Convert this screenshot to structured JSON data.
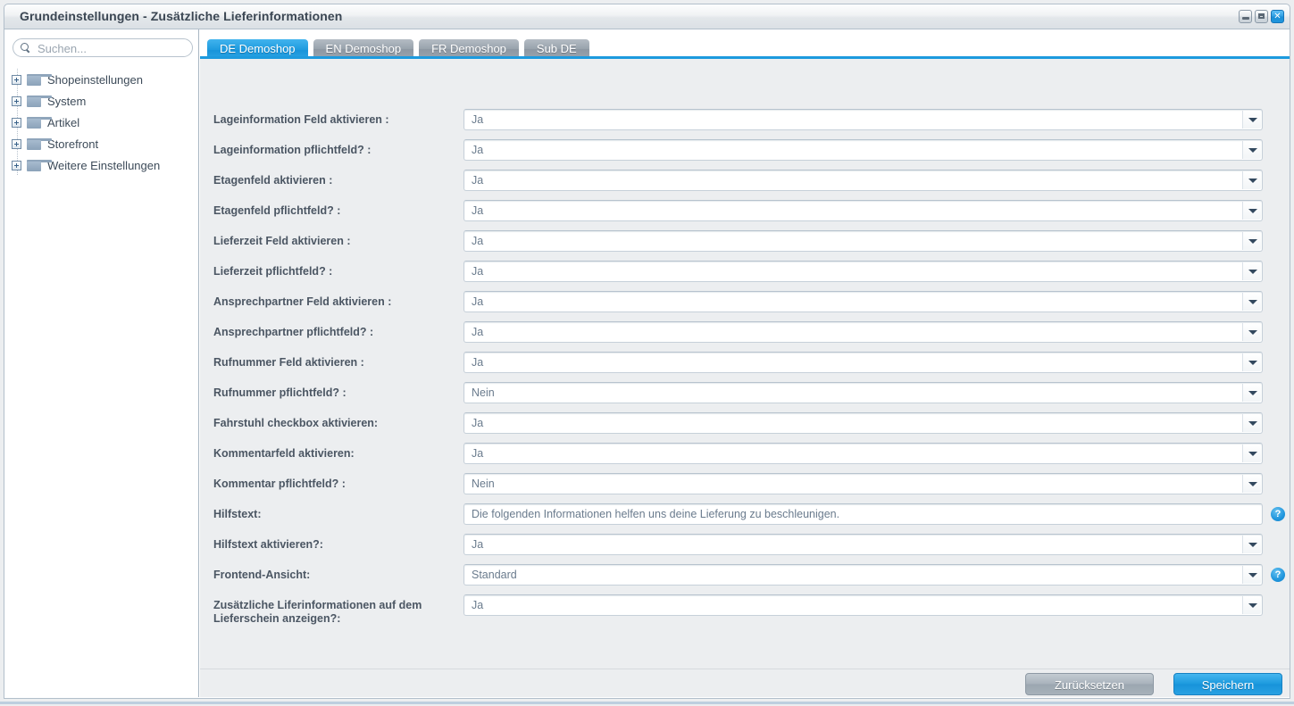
{
  "window": {
    "title": "Grundeinstellungen - Zusätzliche Lieferinformationen",
    "buttons": {
      "minimize": "minimize",
      "maximize": "maximize",
      "close": "✕"
    }
  },
  "sidebar": {
    "search": {
      "placeholder": "Suchen...",
      "value": "",
      "icon": "search-icon"
    },
    "tree": [
      {
        "label": "Shopeinstellungen",
        "icon": "folder-icon",
        "expander": "plus"
      },
      {
        "label": "System",
        "icon": "folder-icon",
        "expander": "plus"
      },
      {
        "label": "Artikel",
        "icon": "folder-icon",
        "expander": "plus"
      },
      {
        "label": "Storefront",
        "icon": "folder-icon",
        "expander": "plus"
      },
      {
        "label": "Weitere Einstellungen",
        "icon": "folder-icon",
        "expander": "plus"
      }
    ]
  },
  "tabs": [
    {
      "label": "DE Demoshop",
      "active": true
    },
    {
      "label": "EN Demoshop",
      "active": false
    },
    {
      "label": "FR Demoshop",
      "active": false
    },
    {
      "label": "Sub DE",
      "active": false
    }
  ],
  "form": {
    "rows": [
      {
        "label": "Lageinformation Feld aktivieren :",
        "value": "Ja",
        "type": "select",
        "help": false
      },
      {
        "label": "Lageinformation pflichtfeld? :",
        "value": "Ja",
        "type": "select",
        "help": false
      },
      {
        "label": "Etagenfeld aktivieren :",
        "value": "Ja",
        "type": "select",
        "help": false
      },
      {
        "label": "Etagenfeld pflichtfeld? :",
        "value": "Ja",
        "type": "select",
        "help": false
      },
      {
        "label": "Lieferzeit Feld aktivieren :",
        "value": "Ja",
        "type": "select",
        "help": false
      },
      {
        "label": "Lieferzeit pflichtfeld? :",
        "value": "Ja",
        "type": "select",
        "help": false
      },
      {
        "label": "Ansprechpartner Feld aktivieren :",
        "value": "Ja",
        "type": "select",
        "help": false
      },
      {
        "label": "Ansprechpartner pflichtfeld? :",
        "value": "Ja",
        "type": "select",
        "help": false
      },
      {
        "label": "Rufnummer Feld aktivieren :",
        "value": "Ja",
        "type": "select",
        "help": false
      },
      {
        "label": "Rufnummer pflichtfeld? :",
        "value": "Nein",
        "type": "select",
        "help": false
      },
      {
        "label": "Fahrstuhl checkbox aktivieren:",
        "value": "Ja",
        "type": "select",
        "help": false
      },
      {
        "label": "Kommentarfeld aktivieren:",
        "value": "Ja",
        "type": "select",
        "help": false
      },
      {
        "label": "Kommentar pflichtfeld? :",
        "value": "Nein",
        "type": "select",
        "help": false
      },
      {
        "label": "Hilfstext:",
        "value": "Die folgenden Informationen helfen uns deine Lieferung zu beschleunigen.",
        "type": "text",
        "help": true
      },
      {
        "label": "Hilfstext aktivieren?:",
        "value": "Ja",
        "type": "select",
        "help": false
      },
      {
        "label": "Frontend-Ansicht:",
        "value": "Standard",
        "type": "select",
        "help": true
      },
      {
        "label": "Zusätzliche Liferinformationen auf dem Lieferschein anzeigen?:",
        "value": "Ja",
        "type": "select",
        "help": false
      }
    ],
    "help_icon_glyph": "?"
  },
  "footer": {
    "reset_label": "Zurücksetzen",
    "save_label": "Speichern"
  },
  "colors": {
    "accent": "#1d9ade",
    "panel_bg": "#eceef0",
    "label_text": "#4b5663",
    "field_text": "#6a7b8d"
  }
}
